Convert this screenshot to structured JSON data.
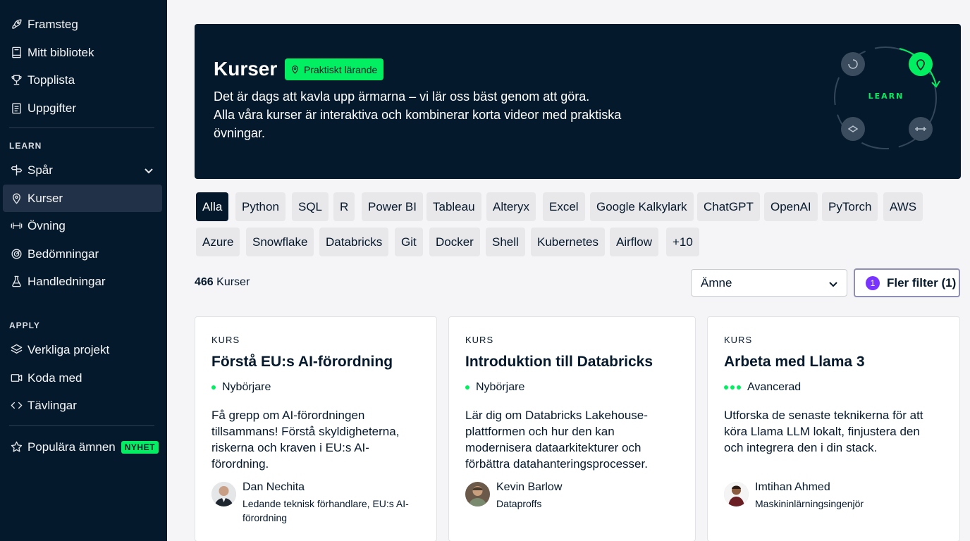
{
  "sidebar": {
    "top_items": [
      {
        "label": "Framsteg",
        "icon": "rocket-icon"
      },
      {
        "label": "Mitt bibliotek",
        "icon": "book-icon"
      },
      {
        "label": "Topplista",
        "icon": "trophy-icon"
      },
      {
        "label": "Uppgifter",
        "icon": "clipboard-icon"
      }
    ],
    "learn_label": "LEARN",
    "learn_items": [
      {
        "label": "Spår",
        "icon": "signpost-icon"
      },
      {
        "label": "Kurser",
        "icon": "map-pin-icon"
      },
      {
        "label": "Övning",
        "icon": "dumbbell-icon"
      },
      {
        "label": "Bedömningar",
        "icon": "gauge-icon"
      },
      {
        "label": "Handledningar",
        "icon": "flask-icon"
      }
    ],
    "apply_label": "APPLY",
    "apply_items": [
      {
        "label": "Verkliga projekt",
        "icon": "layers-icon"
      },
      {
        "label": "Koda med",
        "icon": "video-icon"
      },
      {
        "label": "Tävlingar",
        "icon": "code-icon"
      }
    ],
    "popular": {
      "label": "Populära ämnen",
      "badge": "NYHET",
      "icon": "star-icon"
    }
  },
  "hero": {
    "title": "Kurser",
    "badge": "Praktiskt lärande",
    "line1": "Det är dags att kavla upp ärmarna – vi lär oss bäst genom att göra.",
    "line2": "Alla våra kurser är interaktiva och kombinerar korta videor med praktiska övningar.",
    "graphic_label": "LEARN"
  },
  "chips": [
    "Alla",
    "Python",
    "SQL",
    "R",
    "Power BI",
    "Tableau",
    "Alteryx",
    "Excel",
    "Google Kalkylark",
    "ChatGPT",
    "OpenAI",
    "PyTorch",
    "AWS",
    "Azure",
    "Snowflake",
    "Databricks",
    "Git",
    "Docker",
    "Shell",
    "Kubernetes",
    "Airflow",
    "+10"
  ],
  "results": {
    "count": "466",
    "count_label": " Kurser",
    "subject_select": "Ämne",
    "filter_count": "1",
    "filter_label": "Fler filter (1)"
  },
  "cards": [
    {
      "kind": "KURS",
      "title": "Förstå EU:s AI-förordning",
      "level": "Nybörjare",
      "level_dots": 1,
      "description": "Få grepp om AI-förordningen tillsammans! Förstå skyldigheterna, riskerna och kraven i EU:s AI-förordning.",
      "author": "Dan Nechita",
      "role": "Ledande teknisk förhandlare, EU:s AI-förordning"
    },
    {
      "kind": "KURS",
      "title": "Introduktion till Databricks",
      "level": "Nybörjare",
      "level_dots": 1,
      "description": "Lär dig om Databricks Lakehouse-plattformen och hur den kan modernisera dataarkitekturer och förbättra datahanteringsprocesser.",
      "author": "Kevin Barlow",
      "role": "Dataproffs"
    },
    {
      "kind": "KURS",
      "title": "Arbeta med Llama 3",
      "level": "Avancerad",
      "level_dots": 3,
      "description": "Utforska de senaste teknikerna för att köra Llama LLM lokalt, finjustera den och integrera den i din stack.",
      "author": "Imtihan Ahmed",
      "role": "Maskininlärningsingenjör"
    }
  ],
  "colors": {
    "navy": "#05192d",
    "green": "#03ef62",
    "purple": "#7933ff",
    "active_nav": "#213147"
  }
}
